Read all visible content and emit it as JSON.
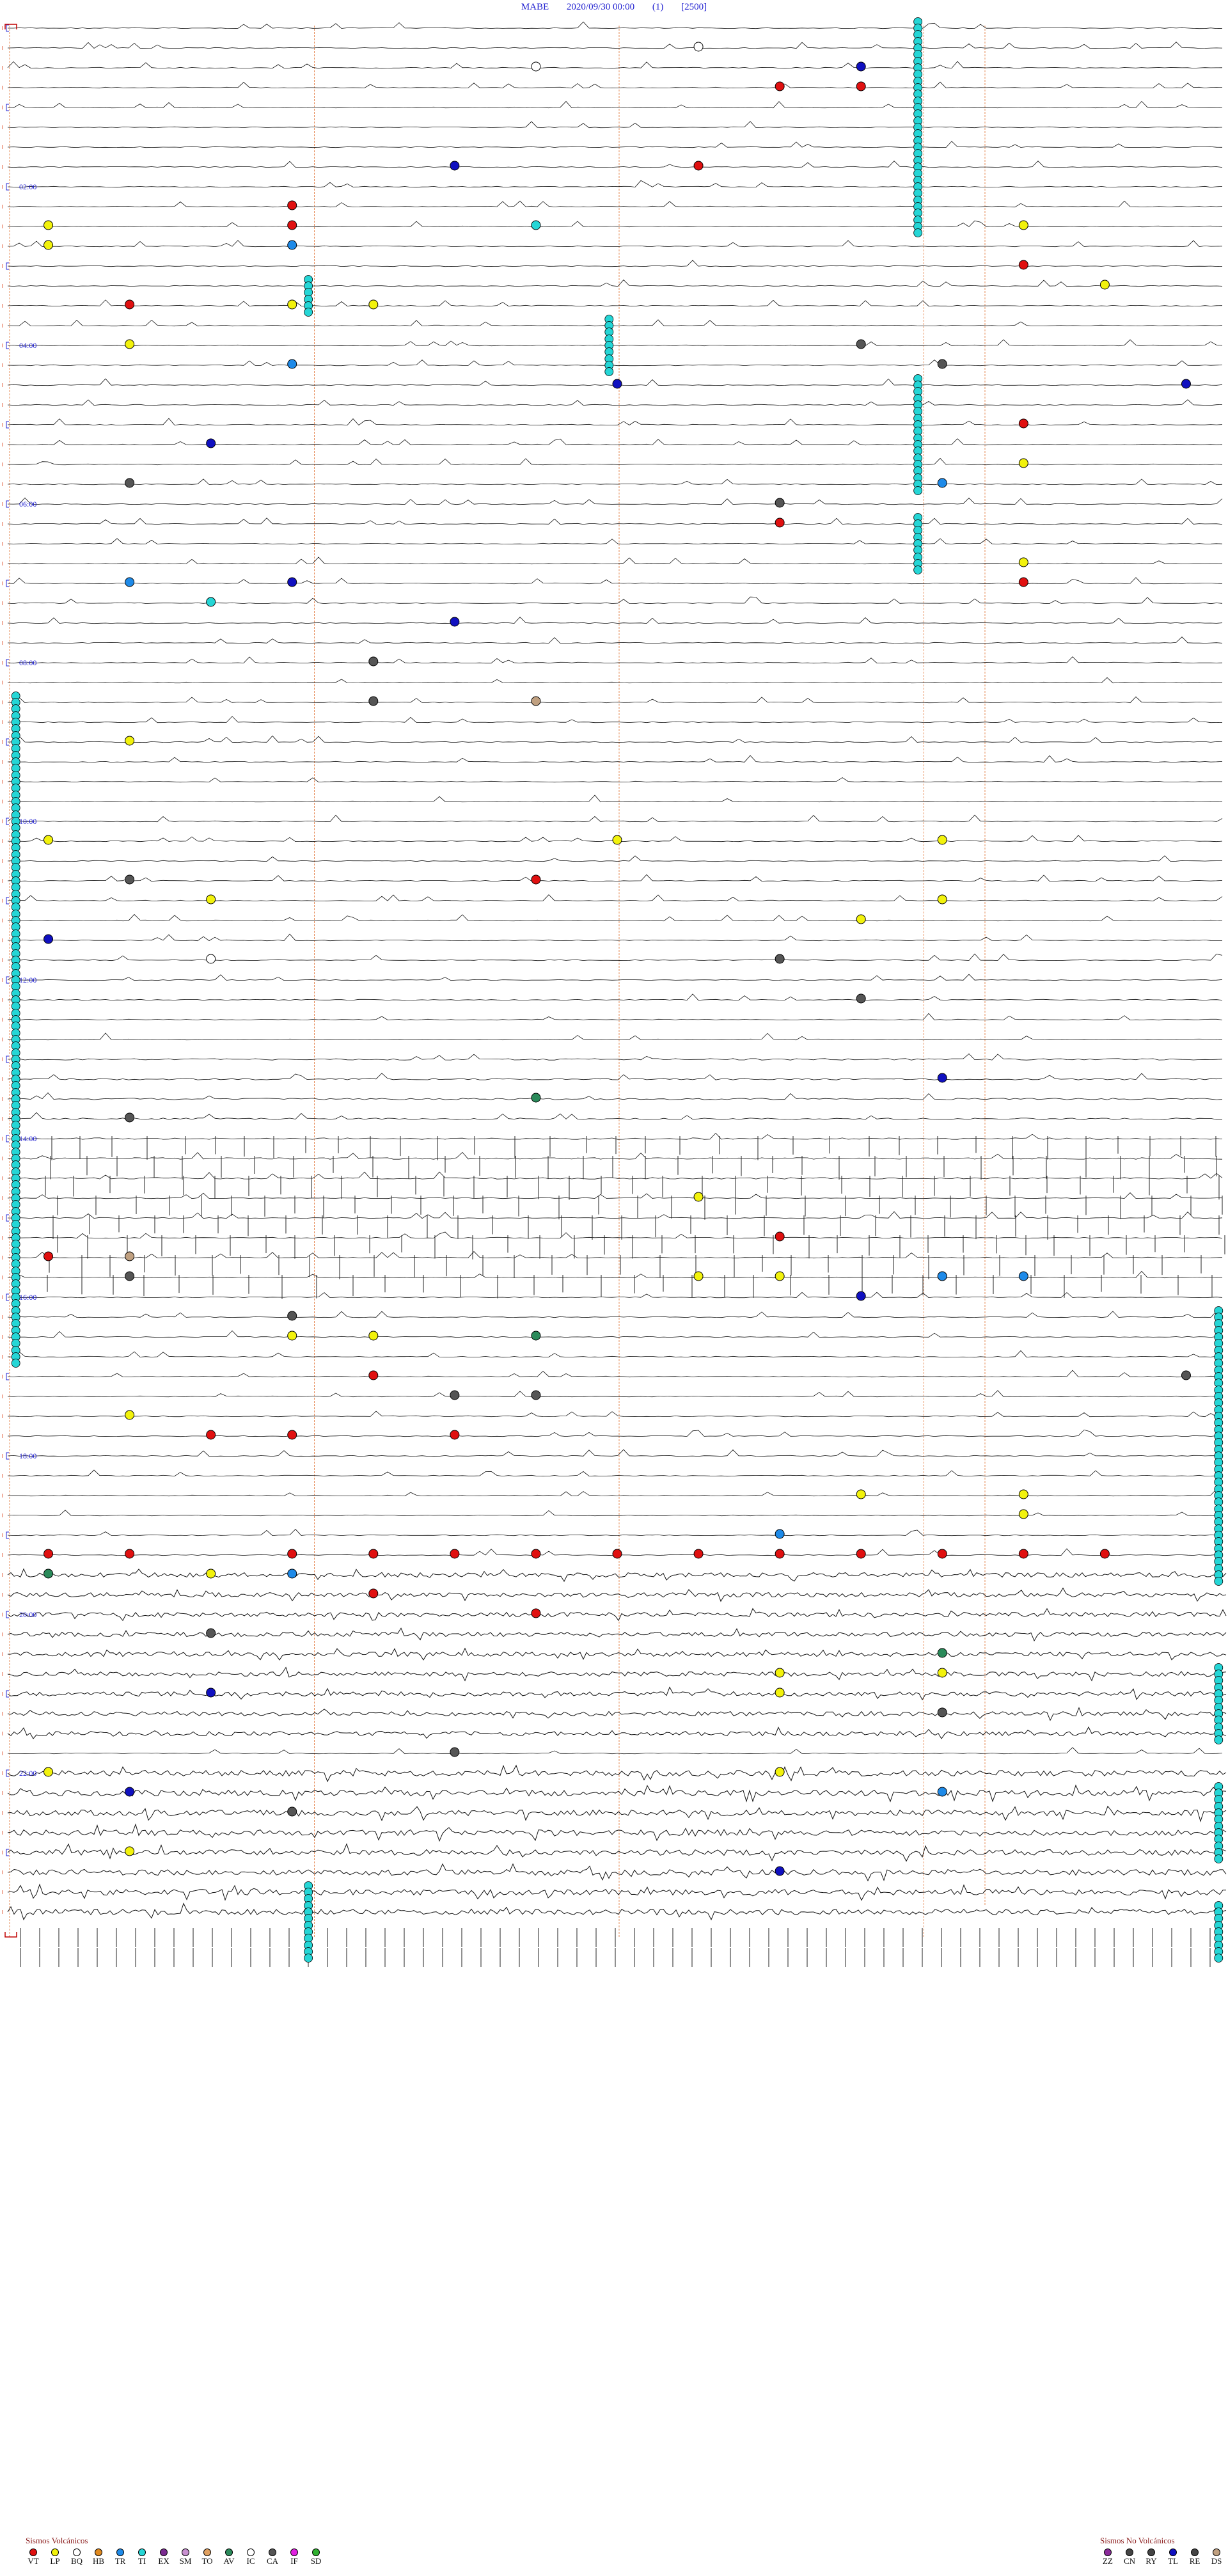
{
  "header": {
    "station": "MABE",
    "datetime": "2020/09/30 00:00",
    "channel": "(1)",
    "scale": "[2500]"
  },
  "chart_data": {
    "type": "helicorder",
    "time_labels": [
      "02:00",
      "04:00",
      "06:00",
      "08:00",
      "10:00",
      "12:00",
      "14:00",
      "16:00",
      "18:00",
      "20:00",
      "22:00"
    ],
    "trace_count": 96,
    "minutes_per_trace": 15,
    "colors": {
      "VT": "#e01010",
      "LP": "#f2f20c",
      "BQ": "#ffffff",
      "HB": "#e08a20",
      "TR": "#1e8ae8",
      "TI": "#25d6d6",
      "EX": "#7a2a90",
      "SM": "#c890d0",
      "TO": "#e0a060",
      "AV": "#2a8a5a",
      "IC": "#ffffff",
      "CA": "#555555",
      "IF": "#e020e0",
      "SD": "#30b030",
      "ZZ": "#8a2a9a",
      "CN": "#444444",
      "RY": "#444444",
      "TL": "#1010c0",
      "RE": "#444444",
      "DS": "#c0a080"
    },
    "events": [
      {
        "trace": 1,
        "minute": 9,
        "type": "BQ"
      },
      {
        "trace": 2,
        "minute": 7,
        "type": "BQ"
      },
      {
        "trace": 2,
        "minute": 11,
        "type": "TL"
      },
      {
        "trace": 3,
        "minute": 10,
        "type": "VT"
      },
      {
        "trace": 3,
        "minute": 11,
        "type": "VT"
      },
      {
        "trace": 7,
        "minute": 6,
        "type": "TL"
      },
      {
        "trace": 7,
        "minute": 9,
        "type": "VT"
      },
      {
        "trace": 9,
        "minute": 4,
        "type": "VT"
      },
      {
        "trace": 10,
        "minute": 1,
        "type": "LP"
      },
      {
        "trace": 10,
        "minute": 4,
        "type": "VT"
      },
      {
        "trace": 10,
        "minute": 7,
        "type": "TI"
      },
      {
        "trace": 10,
        "minute": 13,
        "type": "LP"
      },
      {
        "trace": 11,
        "minute": 4,
        "type": "TR"
      },
      {
        "trace": 11,
        "minute": 1,
        "type": "LP"
      },
      {
        "trace": 12,
        "minute": 13,
        "type": "VT"
      },
      {
        "trace": 13,
        "minute": 14,
        "type": "LP"
      },
      {
        "trace": 14,
        "minute": 2,
        "type": "VT"
      },
      {
        "trace": 14,
        "minute": 4,
        "type": "LP"
      },
      {
        "trace": 14,
        "minute": 5,
        "type": "LP"
      },
      {
        "trace": 16,
        "minute": 11,
        "type": "CA"
      },
      {
        "trace": 16,
        "minute": 2,
        "type": "LP"
      },
      {
        "trace": 17,
        "minute": 4,
        "type": "TR"
      },
      {
        "trace": 17,
        "minute": 12,
        "type": "CA"
      },
      {
        "trace": 18,
        "minute": 8,
        "type": "TL"
      },
      {
        "trace": 18,
        "minute": 15,
        "type": "TL"
      },
      {
        "trace": 20,
        "minute": 13,
        "type": "VT"
      },
      {
        "trace": 21,
        "minute": 3,
        "type": "TL"
      },
      {
        "trace": 22,
        "minute": 13,
        "type": "LP"
      },
      {
        "trace": 23,
        "minute": 2,
        "type": "CA"
      },
      {
        "trace": 23,
        "minute": 12,
        "type": "TR"
      },
      {
        "trace": 24,
        "minute": 10,
        "type": "CA"
      },
      {
        "trace": 25,
        "minute": 10,
        "type": "VT"
      },
      {
        "trace": 27,
        "minute": 13,
        "type": "LP"
      },
      {
        "trace": 28,
        "minute": 2,
        "type": "TR"
      },
      {
        "trace": 28,
        "minute": 4,
        "type": "TL"
      },
      {
        "trace": 28,
        "minute": 13,
        "type": "VT"
      },
      {
        "trace": 29,
        "minute": 3,
        "type": "TI"
      },
      {
        "trace": 30,
        "minute": 6,
        "type": "TL"
      },
      {
        "trace": 32,
        "minute": 5,
        "type": "CA"
      },
      {
        "trace": 34,
        "minute": 5,
        "type": "CA"
      },
      {
        "trace": 34,
        "minute": 7,
        "type": "DS"
      },
      {
        "trace": 36,
        "minute": 2,
        "type": "LP"
      },
      {
        "trace": 41,
        "minute": 1,
        "type": "LP"
      },
      {
        "trace": 41,
        "minute": 8,
        "type": "LP"
      },
      {
        "trace": 41,
        "minute": 12,
        "type": "LP"
      },
      {
        "trace": 43,
        "minute": 2,
        "type": "CA"
      },
      {
        "trace": 43,
        "minute": 7,
        "type": "VT"
      },
      {
        "trace": 44,
        "minute": 3,
        "type": "LP"
      },
      {
        "trace": 44,
        "minute": 12,
        "type": "LP"
      },
      {
        "trace": 45,
        "minute": 11,
        "type": "LP"
      },
      {
        "trace": 46,
        "minute": 1,
        "type": "TL"
      },
      {
        "trace": 47,
        "minute": 3,
        "type": "BQ"
      },
      {
        "trace": 47,
        "minute": 10,
        "type": "CA"
      },
      {
        "trace": 49,
        "minute": 11,
        "type": "CA"
      },
      {
        "trace": 53,
        "minute": 12,
        "type": "TL"
      },
      {
        "trace": 54,
        "minute": 7,
        "type": "AV"
      },
      {
        "trace": 55,
        "minute": 2,
        "type": "CA"
      },
      {
        "trace": 59,
        "minute": 9,
        "type": "LP"
      },
      {
        "trace": 61,
        "minute": 10,
        "type": "VT"
      },
      {
        "trace": 62,
        "minute": 1,
        "type": "VT"
      },
      {
        "trace": 62,
        "minute": 2,
        "type": "DS"
      },
      {
        "trace": 63,
        "minute": 2,
        "type": "CA"
      },
      {
        "trace": 63,
        "minute": 9,
        "type": "LP"
      },
      {
        "trace": 63,
        "minute": 10,
        "type": "LP"
      },
      {
        "trace": 63,
        "minute": 12,
        "type": "CA"
      },
      {
        "trace": 63,
        "minute": 12,
        "type": "TR"
      },
      {
        "trace": 63,
        "minute": 13,
        "type": "TR"
      },
      {
        "trace": 64,
        "minute": 11,
        "type": "TL"
      },
      {
        "trace": 65,
        "minute": 4,
        "type": "CA"
      },
      {
        "trace": 66,
        "minute": 4,
        "type": "LP"
      },
      {
        "trace": 66,
        "minute": 5,
        "type": "LP"
      },
      {
        "trace": 66,
        "minute": 7,
        "type": "AV"
      },
      {
        "trace": 68,
        "minute": 5,
        "type": "VT"
      },
      {
        "trace": 68,
        "minute": 15,
        "type": "CA"
      },
      {
        "trace": 69,
        "minute": 6,
        "type": "CA"
      },
      {
        "trace": 69,
        "minute": 7,
        "type": "CA"
      },
      {
        "trace": 70,
        "minute": 2,
        "type": "LP"
      },
      {
        "trace": 71,
        "minute": 3,
        "type": "VT"
      },
      {
        "trace": 71,
        "minute": 4,
        "type": "VT"
      },
      {
        "trace": 71,
        "minute": 6,
        "type": "VT"
      },
      {
        "trace": 74,
        "minute": 11,
        "type": "LP"
      },
      {
        "trace": 74,
        "minute": 13,
        "type": "LP"
      },
      {
        "trace": 75,
        "minute": 13,
        "type": "LP"
      },
      {
        "trace": 76,
        "minute": 10,
        "type": "TR"
      },
      {
        "trace": 77,
        "minute": 1,
        "type": "VT"
      },
      {
        "trace": 77,
        "minute": 2,
        "type": "VT"
      },
      {
        "trace": 77,
        "minute": 4,
        "type": "VT"
      },
      {
        "trace": 77,
        "minute": 5,
        "type": "VT"
      },
      {
        "trace": 77,
        "minute": 6,
        "type": "VT"
      },
      {
        "trace": 77,
        "minute": 7,
        "type": "VT"
      },
      {
        "trace": 77,
        "minute": 8,
        "type": "VT"
      },
      {
        "trace": 77,
        "minute": 9,
        "type": "VT"
      },
      {
        "trace": 77,
        "minute": 10,
        "type": "VT"
      },
      {
        "trace": 77,
        "minute": 11,
        "type": "VT"
      },
      {
        "trace": 77,
        "minute": 12,
        "type": "VT"
      },
      {
        "trace": 77,
        "minute": 13,
        "type": "VT"
      },
      {
        "trace": 77,
        "minute": 14,
        "type": "VT"
      },
      {
        "trace": 78,
        "minute": 1,
        "type": "AV"
      },
      {
        "trace": 78,
        "minute": 3,
        "type": "LP"
      },
      {
        "trace": 78,
        "minute": 4,
        "type": "TR"
      },
      {
        "trace": 79,
        "minute": 5,
        "type": "VT"
      },
      {
        "trace": 80,
        "minute": 7,
        "type": "VT"
      },
      {
        "trace": 81,
        "minute": 3,
        "type": "CA"
      },
      {
        "trace": 82,
        "minute": 12,
        "type": "AV"
      },
      {
        "trace": 83,
        "minute": 10,
        "type": "LP"
      },
      {
        "trace": 83,
        "minute": 12,
        "type": "LP"
      },
      {
        "trace": 84,
        "minute": 3,
        "type": "TL"
      },
      {
        "trace": 84,
        "minute": 10,
        "type": "LP"
      },
      {
        "trace": 85,
        "minute": 12,
        "type": "CA"
      },
      {
        "trace": 87,
        "minute": 6,
        "type": "CA"
      },
      {
        "trace": 88,
        "minute": 1,
        "type": "LP"
      },
      {
        "trace": 88,
        "minute": 10,
        "type": "LP"
      },
      {
        "trace": 89,
        "minute": 2,
        "type": "TL"
      },
      {
        "trace": 89,
        "minute": 12,
        "type": "TR"
      },
      {
        "trace": 90,
        "minute": 4,
        "type": "CA"
      },
      {
        "trace": 92,
        "minute": 2,
        "type": "LP"
      },
      {
        "trace": 93,
        "minute": 10,
        "type": "TL"
      }
    ],
    "ti_columns": [
      {
        "minute": 11.2,
        "from_trace": 0,
        "to_trace": 10
      },
      {
        "minute": 11.2,
        "from_trace": 18,
        "to_trace": 23
      },
      {
        "minute": 11.2,
        "from_trace": 25,
        "to_trace": 27
      },
      {
        "minute": 3.7,
        "from_trace": 13,
        "to_trace": 14
      },
      {
        "minute": 7.4,
        "from_trace": 15,
        "to_trace": 17
      },
      {
        "minute": 0.1,
        "from_trace": 34,
        "to_trace": 67
      },
      {
        "minute": 14.9,
        "from_trace": 65,
        "to_trace": 78
      },
      {
        "minute": 14.9,
        "from_trace": 83,
        "to_trace": 86
      },
      {
        "minute": 14.9,
        "from_trace": 89,
        "to_trace": 92
      },
      {
        "minute": 14.9,
        "from_trace": 95,
        "to_trace": 97
      },
      {
        "minute": 3.7,
        "from_trace": 94,
        "to_trace": 97
      }
    ]
  },
  "legend_volcanic": {
    "title": "Sismos Volcánicos",
    "items": [
      "VT",
      "LP",
      "BQ",
      "HB",
      "TR",
      "TI",
      "EX",
      "SM",
      "TO",
      "AV",
      "IC",
      "CA",
      "IF",
      "SD"
    ]
  },
  "legend_nonvolcanic": {
    "title": "Sismos No Volcánicos",
    "items": [
      "ZZ",
      "CN",
      "RY",
      "TL",
      "RE",
      "DS"
    ]
  }
}
